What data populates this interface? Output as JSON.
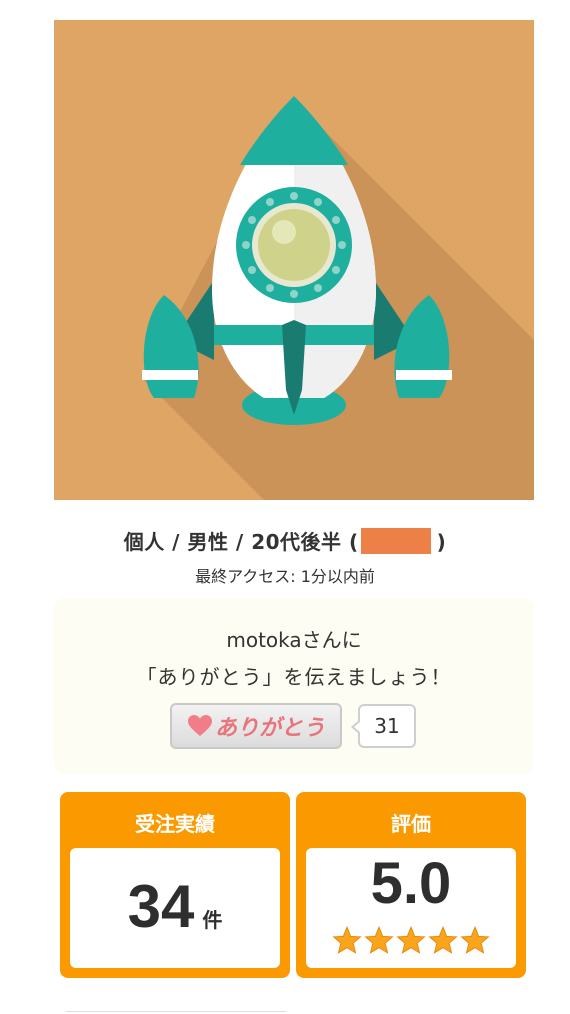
{
  "profile": {
    "avatar_alt": "rocket",
    "type": "個人",
    "gender": "男性",
    "age": "20代後半",
    "separator": " / ",
    "paren_open": "(",
    "paren_close": ")",
    "last_access": "最終アクセス: 1分以内前"
  },
  "thanks": {
    "line1": "motokaさんに",
    "line2": "「ありがとう」を伝えましょう！",
    "button_label": "ありがとう",
    "count": "31",
    "icon": "heart-icon"
  },
  "stats": {
    "orders": {
      "title": "受注実績",
      "value": "34",
      "unit": "件"
    },
    "rating": {
      "title": "評価",
      "value": "5.0",
      "stars": 5
    }
  },
  "colors": {
    "avatar_bg": "#dea565",
    "rocket_teal": "#1faf9f",
    "card_orange": "#fb9a00",
    "star": "#fba51c",
    "heart": "#f17d89"
  }
}
